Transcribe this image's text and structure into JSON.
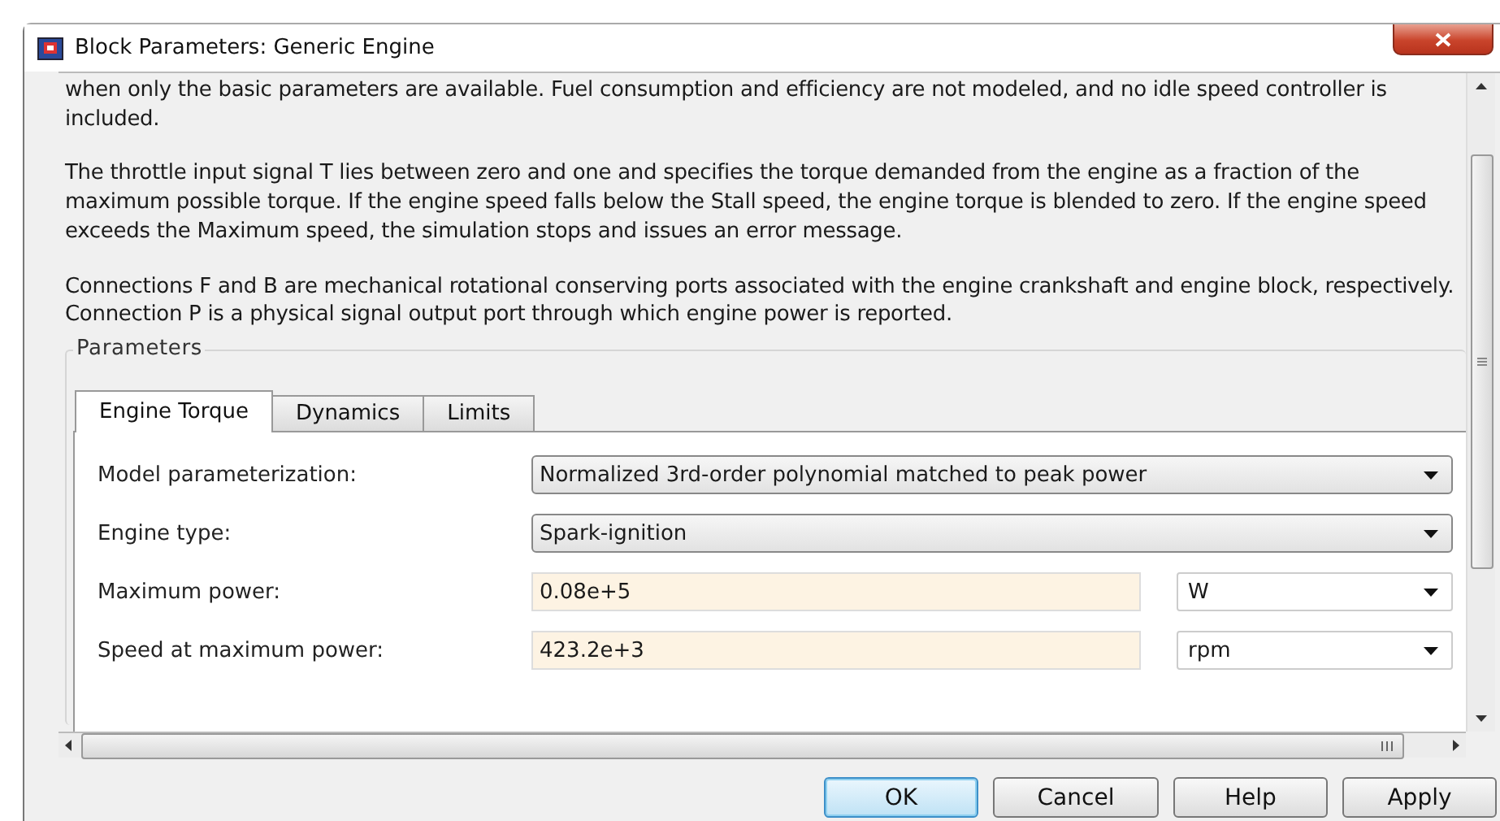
{
  "window": {
    "title": "Block Parameters: Generic Engine"
  },
  "description": [
    "when only the basic parameters are available. Fuel consumption and efficiency are not modeled, and no idle speed controller is included.",
    "The throttle input signal T lies between zero and one and specifies the torque demanded from the engine as a fraction of the maximum possible torque. If the engine speed falls below the Stall speed, the engine torque is blended to zero. If the engine speed exceeds the Maximum speed, the simulation stops and issues an error message.",
    "Connections F and B are mechanical rotational conserving ports associated with the engine crankshaft and engine block, respectively. Connection P is a physical signal output port through which engine power is reported."
  ],
  "parameters": {
    "title": "Parameters",
    "tabs": [
      {
        "label": "Engine Torque",
        "selected": true
      },
      {
        "label": "Dynamics",
        "selected": false
      },
      {
        "label": "Limits",
        "selected": false
      }
    ],
    "fields": [
      {
        "kind": "dropdown",
        "label": "Model parameterization:",
        "value": "Normalized 3rd-order polynomial matched to peak power"
      },
      {
        "kind": "dropdown",
        "label": "Engine type:",
        "value": "Spark-ignition"
      },
      {
        "kind": "input",
        "label": "Maximum power:",
        "value": "0.08e+5",
        "unit": "W"
      },
      {
        "kind": "input",
        "label": "Speed at maximum power:",
        "value": "423.2e+3",
        "unit": "rpm"
      }
    ]
  },
  "buttons": [
    {
      "label": "OK",
      "default": true
    },
    {
      "label": "Cancel",
      "default": false
    },
    {
      "label": "Help",
      "default": false
    },
    {
      "label": "Apply",
      "default": false
    }
  ]
}
